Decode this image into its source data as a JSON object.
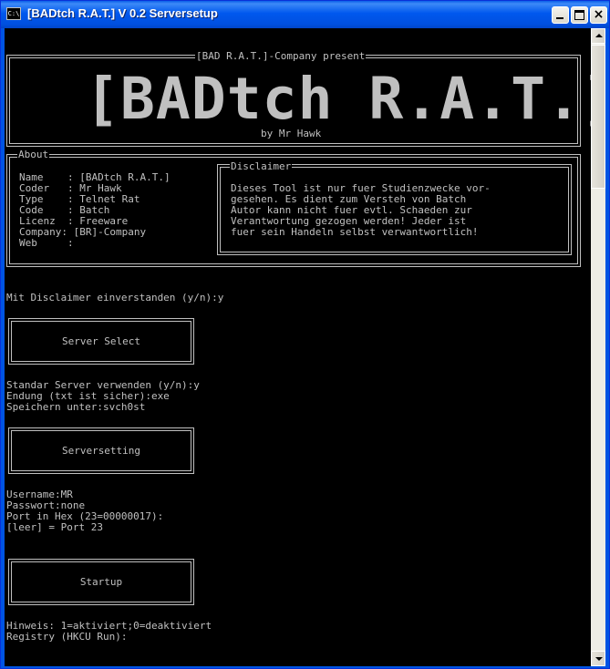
{
  "window": {
    "icon_text": "C:\\",
    "title": "[BADtch R.A.T.] V 0.2 Serversetup",
    "close_glyph": "×"
  },
  "header": {
    "present": "[BAD R.A.T.]-Company present",
    "logo": "[BADtch R.A.T.]",
    "author": "by Mr Hawk"
  },
  "about": {
    "legend": "About",
    "rows": [
      "Name    : [BADtch R.A.T.]",
      "Coder   : Mr Hawk",
      "Type    : Telnet Rat",
      "Code    : Batch",
      "Licenz  : Freeware",
      "Company: [BR]-Company",
      "Web     :"
    ]
  },
  "disclaimer": {
    "legend": "Disclaimer",
    "lines": [
      "Dieses Tool ist nur fuer Studienzwecke vor-",
      "gesehen. Es dient zum Versteh von Batch",
      "Autor kann nicht fuer evtl. Schaeden zur",
      "Verantwortung gezogen werden! Jeder ist",
      "fuer sein Handeln selbst verwantwortlich!"
    ]
  },
  "prompts": {
    "disclaimer_accept": "Mit Disclaimer einverstanden (y/n):y",
    "server_lines": [
      "Standar Server verwenden (y/n):y",
      "Endung (txt ist sicher):exe",
      "Speichern unter:svch0st"
    ],
    "setting_lines": [
      "Username:MR",
      "Passwort:none",
      "Port in Hex (23=00000017):",
      "[leer] = Port 23"
    ],
    "startup_lines": [
      "Hinweis: 1=aktiviert;0=deaktiviert",
      "Registry (HKCU Run):"
    ]
  },
  "sections": {
    "server_select": "Server Select",
    "serversetting": "Serversetting",
    "startup": "Startup"
  }
}
